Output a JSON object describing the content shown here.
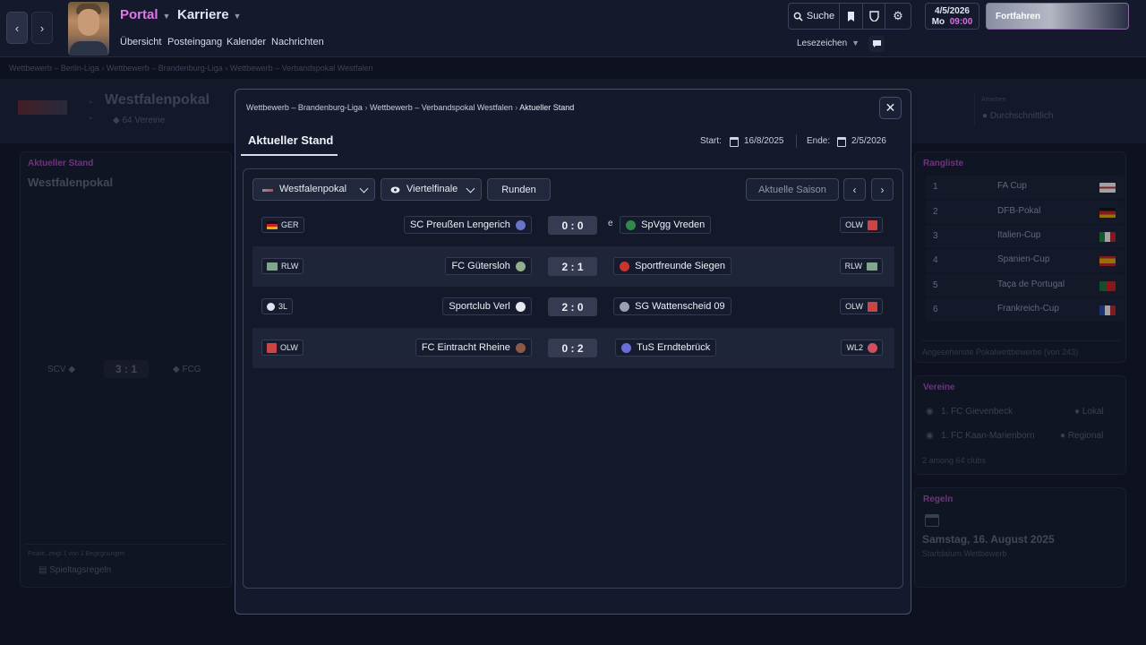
{
  "topbar": {
    "portal": "Portal",
    "karriere": "Karriere",
    "nav": [
      "Übersicht",
      "Posteingang",
      "Kalender",
      "Nachrichten"
    ],
    "search_label": "Suche",
    "date": "4/5/2026",
    "weekday": "Mo",
    "time": "09:00",
    "continue": "Fortfahren",
    "bookmarks": "Lesezeichen"
  },
  "background": {
    "breadcrumb": [
      "Wettbewerb – Berlin-Liga",
      "Wettbewerb – Brandenburg-Liga",
      "Wettbewerb – Verbandspokal Westfalen"
    ],
    "hero_title": "Westfalenpokal",
    "hero_sub": "64 Vereine",
    "hero_right_label": "Ansehen",
    "hero_right_value": "Durchschnittlich",
    "left_panel": {
      "label": "Aktueller Stand",
      "title": "Westfalenpokal",
      "home": "SCV",
      "score": "3 : 1",
      "away": "FCG",
      "footnote": "Finale, zeigt 1 von 1 Begegnungen",
      "rules_link": "Spieltagsregeln"
    },
    "ranking": {
      "title": "Rangliste",
      "rows": [
        {
          "rank": "1",
          "name": "FA Cup"
        },
        {
          "rank": "2",
          "name": "DFB-Pokal"
        },
        {
          "rank": "3",
          "name": "Italien-Cup"
        },
        {
          "rank": "4",
          "name": "Spanien-Cup"
        },
        {
          "rank": "5",
          "name": "Taça de Portugal"
        },
        {
          "rank": "6",
          "name": "Frankreich-Cup"
        }
      ],
      "footer": "Angesehenste Pokalwettbewerbe (von 243)"
    },
    "clubs": {
      "title": "Vereine",
      "c1": "1. FC Gievenbeck",
      "c1_tag": "Lokal",
      "c2": "1. FC Kaan-Marienborn",
      "c2_tag": "Regional",
      "footer": "2 among 64 clubs"
    },
    "rules": {
      "title": "Regeln",
      "date": "Samstag, 16. August 2025",
      "sub": "Startdatum Wettbewerb"
    }
  },
  "modal": {
    "breadcrumb": [
      "Wettbewerb – Brandenburg-Liga",
      "Wettbewerb – Verbandspokal Westfalen"
    ],
    "breadcrumb_current": "Aktueller Stand",
    "tab": "Aktueller Stand",
    "start_label": "Start:",
    "start_date": "16/8/2025",
    "end_label": "Ende:",
    "end_date": "2/5/2026",
    "filter_competition": "Westfalenpokal",
    "filter_round": "Viertelfinale",
    "rounds_button": "Runden",
    "season_button": "Aktuelle Saison",
    "matches": [
      {
        "home_league": "GER",
        "home": "SC Preußen Lengerich",
        "score": "0 : 0",
        "note": "e",
        "away": "SpVgg Vreden",
        "away_league": "OLW"
      },
      {
        "home_league": "RLW",
        "home": "FC Gütersloh",
        "score": "2 : 1",
        "note": "",
        "away": "Sportfreunde Siegen",
        "away_league": "RLW"
      },
      {
        "home_league": "3L",
        "home": "Sportclub Verl",
        "score": "2 : 0",
        "note": "",
        "away": "SG Wattenscheid 09",
        "away_league": "OLW"
      },
      {
        "home_league": "OLW",
        "home": "FC Eintracht Rheine",
        "score": "0 : 2",
        "note": "",
        "away": "TuS Erndtebrück",
        "away_league": "WL2"
      }
    ]
  }
}
